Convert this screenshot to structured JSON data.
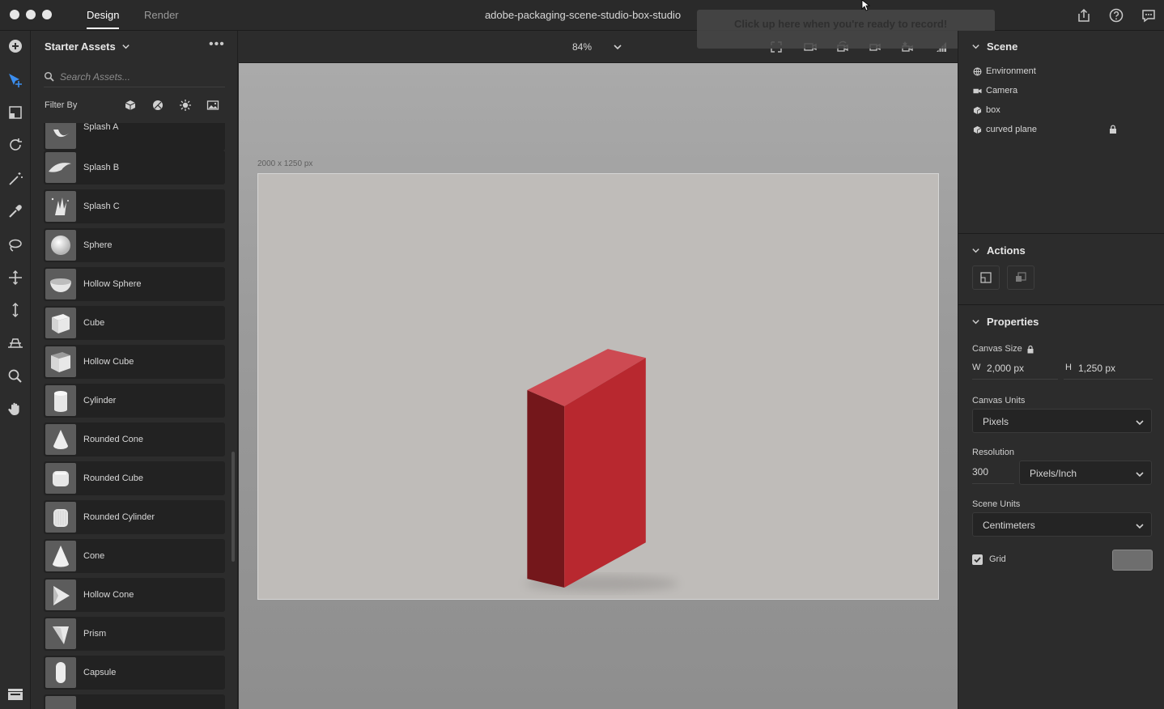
{
  "window": {
    "title": "adobe-packaging-scene-studio-box-studio",
    "tabs": [
      {
        "label": "Design",
        "active": true
      },
      {
        "label": "Render",
        "active": false
      }
    ]
  },
  "tooltip": {
    "text": "Click up here when you're ready to record!"
  },
  "assets": {
    "header": "Starter Assets",
    "more": "•••",
    "search_placeholder": "Search Assets...",
    "filter_label": "Filter By",
    "items": [
      {
        "label": "Splash A"
      },
      {
        "label": "Splash B"
      },
      {
        "label": "Splash C"
      },
      {
        "label": "Sphere"
      },
      {
        "label": "Hollow Sphere"
      },
      {
        "label": "Cube"
      },
      {
        "label": "Hollow Cube"
      },
      {
        "label": "Cylinder"
      },
      {
        "label": "Rounded Cone"
      },
      {
        "label": "Rounded Cube"
      },
      {
        "label": "Rounded Cylinder"
      },
      {
        "label": "Cone"
      },
      {
        "label": "Hollow Cone"
      },
      {
        "label": "Prism"
      },
      {
        "label": "Capsule"
      }
    ]
  },
  "canvas": {
    "zoom": "84%",
    "size_label": "2000 x 1250 px",
    "box_color_front": "#b8282f",
    "box_color_side": "#74171b",
    "box_color_top": "#cd4a52"
  },
  "scene": {
    "title": "Scene",
    "items": [
      {
        "label": "Environment",
        "icon": "globe-icon"
      },
      {
        "label": "Camera",
        "icon": "camera-icon"
      },
      {
        "label": "box",
        "icon": "model-icon"
      },
      {
        "label": "curved plane",
        "icon": "model-icon",
        "locked": true
      }
    ]
  },
  "actions": {
    "title": "Actions"
  },
  "properties": {
    "title": "Properties",
    "canvas_size_label": "Canvas Size",
    "w_label": "W",
    "w_value": "2,000 px",
    "h_label": "H",
    "h_value": "1,250 px",
    "canvas_units_label": "Canvas Units",
    "canvas_units_value": "Pixels",
    "resolution_label": "Resolution",
    "resolution_value": "300",
    "resolution_unit": "Pixels/Inch",
    "scene_units_label": "Scene Units",
    "scene_units_value": "Centimeters",
    "grid_label": "Grid",
    "grid_checked": true
  }
}
